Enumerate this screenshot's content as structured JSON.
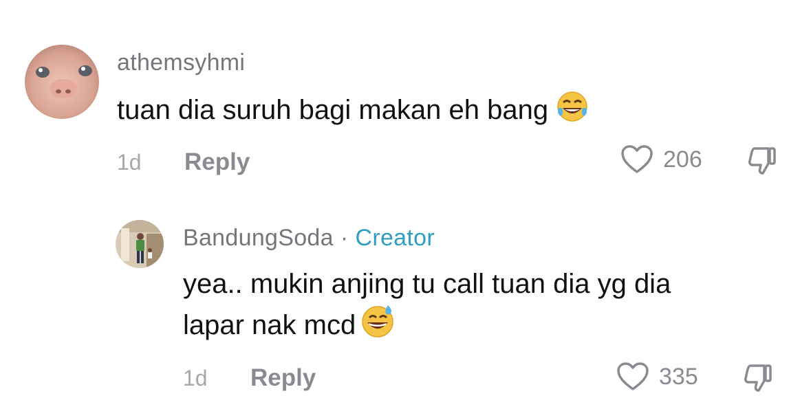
{
  "comments": [
    {
      "username": "athemsyhmi",
      "text": "tuan dia suruh bagi makan eh bang",
      "emoji": "tears-of-joy-emoji",
      "time": "1d",
      "reply_label": "Reply",
      "likes": "206"
    },
    {
      "username": "BandungSoda",
      "separator": "·",
      "badge": "Creator",
      "text_line1": "yea.. mukin anjing tu call tuan dia yg dia",
      "text_line2": "lapar nak mcd",
      "emoji": "grinning-sweat-emoji",
      "time": "1d",
      "reply_label": "Reply",
      "likes": "335"
    }
  ],
  "colors": {
    "username": "#75767c",
    "creator_badge": "#2f9ec2",
    "meta": "#a7a8ac",
    "text": "#111111"
  }
}
